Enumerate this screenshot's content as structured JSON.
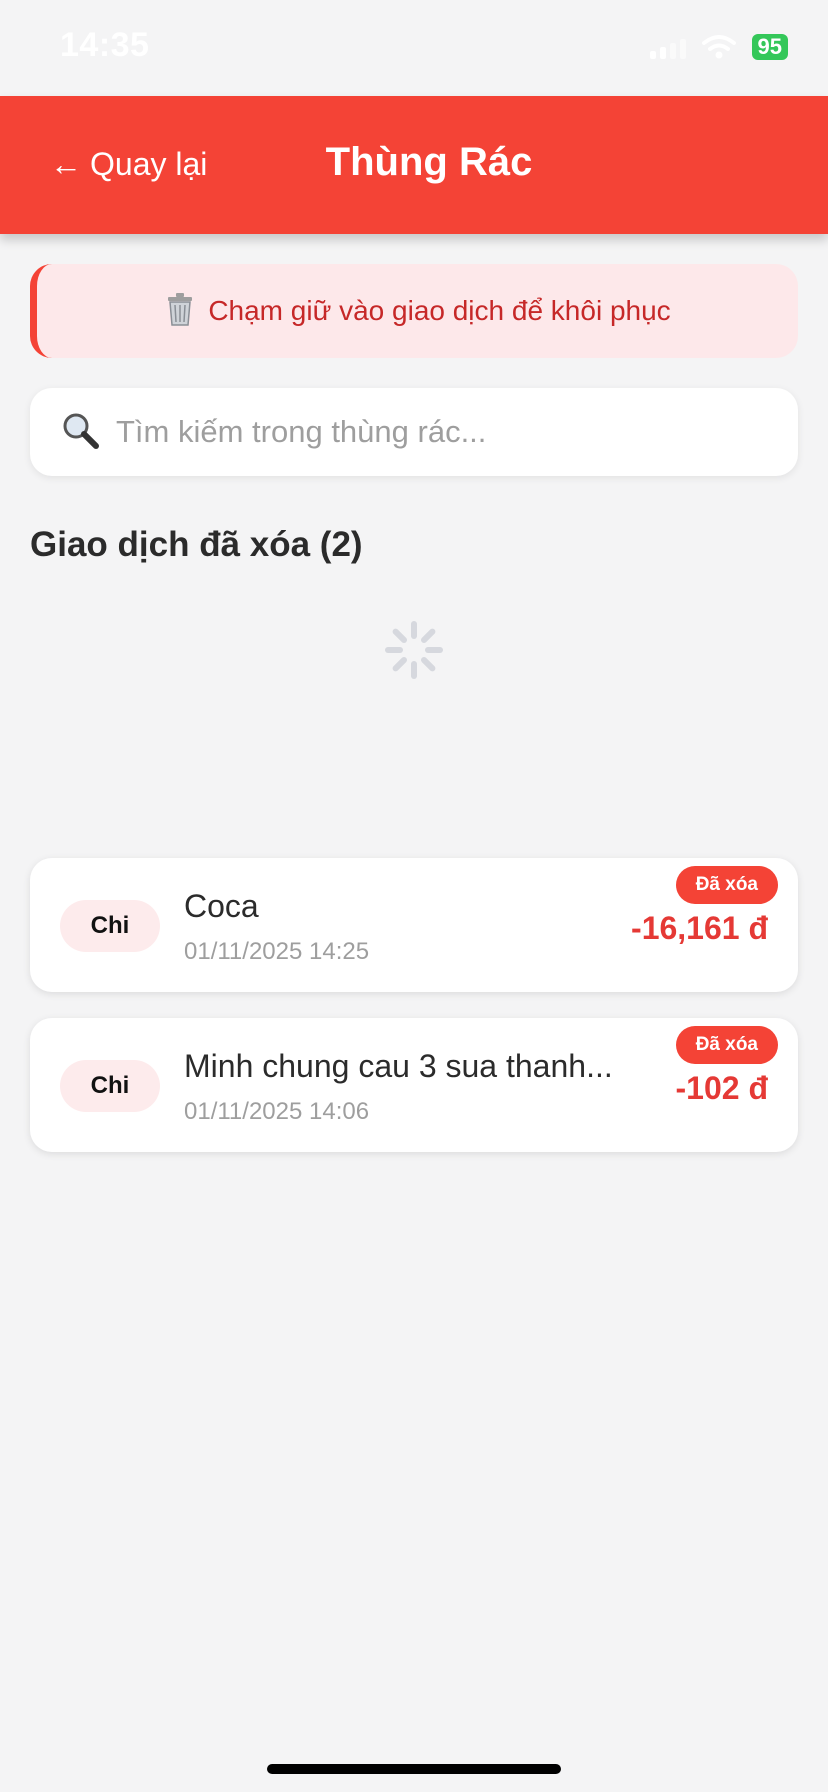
{
  "status_bar": {
    "time": "14:35",
    "battery": "95"
  },
  "header": {
    "back_label": "Quay lại",
    "title": "Thùng Rác"
  },
  "notice": {
    "text": "Chạm giữ vào giao dịch để khôi phục"
  },
  "search": {
    "placeholder": "Tìm kiếm trong thùng rác..."
  },
  "section": {
    "title": "Giao dịch đã xóa (2)"
  },
  "transactions": [
    {
      "type": "Chi",
      "name": "Coca",
      "date": "01/11/2025 14:25",
      "amount": "-16,161 đ",
      "badge": "Đã xóa"
    },
    {
      "type": "Chi",
      "name": "Minh chung cau 3 sua thanh...",
      "date": "01/11/2025 14:06",
      "amount": "-102 đ",
      "badge": "Đã xóa"
    }
  ],
  "colors": {
    "accent": "#f44336",
    "amount": "#e53935",
    "battery": "#34c759"
  }
}
